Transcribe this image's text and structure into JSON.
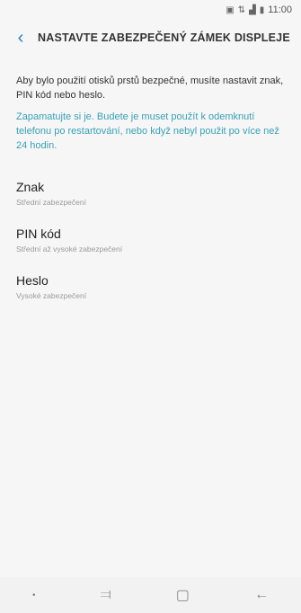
{
  "status": {
    "time": "11:00"
  },
  "header": {
    "back_icon": "chevron-left-icon",
    "title": "NASTAVTE ZABEZPEČENÝ ZÁMEK DISPLEJE"
  },
  "content": {
    "description": "Aby bylo použití otisků prstů bezpečné, musíte nastavit znak, PIN kód nebo heslo.",
    "note": "Zapamatujte si je. Budete je muset použít k odemknutí telefonu po restartování, nebo když nebyl použit po více než 24 hodin.",
    "options": [
      {
        "title": "Znak",
        "subtitle": "Střední zabezpečení"
      },
      {
        "title": "PIN kód",
        "subtitle": "Střední až vysoké zabezpečení"
      },
      {
        "title": "Heslo",
        "subtitle": "Vysoké zabezpečení"
      }
    ]
  },
  "navbar": {
    "recent_icon": "recent-apps-icon",
    "home_icon": "home-icon",
    "back_icon": "back-arrow-icon"
  },
  "colors": {
    "accent": "#3aa0b5",
    "back": "#2a7fb5"
  }
}
